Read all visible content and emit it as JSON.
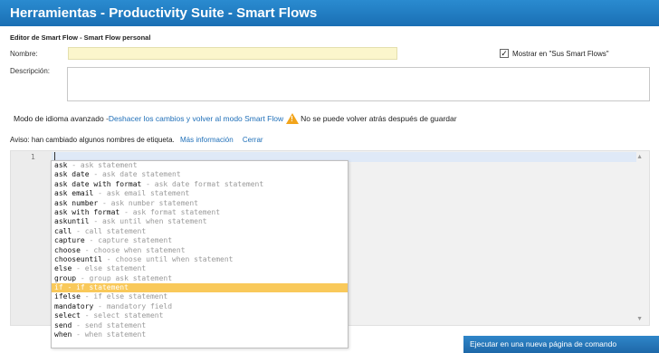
{
  "window": {
    "title": "Herramientas - Productivity Suite - Smart Flows"
  },
  "editor_header": {
    "subtitle": "Editor de Smart Flow - Smart Flow personal"
  },
  "form": {
    "name_label": "Nombre:",
    "name_value": "",
    "show_checkbox_label": "Mostrar en \"Sus Smart Flows\"",
    "show_checked": true,
    "description_label": "Descripción:",
    "description_value": ""
  },
  "mode": {
    "prefix": "Modo de idioma avanzado - ",
    "undo_link": "Deshacer los cambios y volver al modo Smart Flow",
    "warning_text": "No se puede volver atrás después de guardar"
  },
  "notice": {
    "text": "Aviso: han cambiado algunos nombres de etiqueta.",
    "more_info_link": "Más información",
    "close_link": "Cerrar"
  },
  "code_editor": {
    "line_number": "1",
    "autocomplete": [
      {
        "keyword": "ask",
        "desc": "ask statement"
      },
      {
        "keyword": "ask date",
        "desc": "ask date statement"
      },
      {
        "keyword": "ask date with format",
        "desc": "ask date format statement"
      },
      {
        "keyword": "ask email",
        "desc": "ask email statement"
      },
      {
        "keyword": "ask number",
        "desc": "ask number statement"
      },
      {
        "keyword": "ask with format",
        "desc": "ask format statement"
      },
      {
        "keyword": "askuntil",
        "desc": "ask until when statement"
      },
      {
        "keyword": "call",
        "desc": "call statement"
      },
      {
        "keyword": "capture",
        "desc": "capture statement"
      },
      {
        "keyword": "choose",
        "desc": "choose when statement"
      },
      {
        "keyword": "chooseuntil",
        "desc": "choose until when statement"
      },
      {
        "keyword": "else",
        "desc": "else statement"
      },
      {
        "keyword": "group",
        "desc": "group ask statement"
      },
      {
        "keyword": "if",
        "desc": "if statement",
        "selected": true
      },
      {
        "keyword": "ifelse",
        "desc": "if else statement"
      },
      {
        "keyword": "mandatory",
        "desc": "mandatory field"
      },
      {
        "keyword": "select",
        "desc": "select statement"
      },
      {
        "keyword": "send",
        "desc": "send statement"
      },
      {
        "keyword": "when",
        "desc": "when statement"
      }
    ]
  },
  "actions": {
    "run_button": "Ejecutar en una nueva página de comando"
  },
  "colors": {
    "accent": "#1a6fb4",
    "warning": "#f2a41b",
    "selection": "#f9c95a"
  }
}
